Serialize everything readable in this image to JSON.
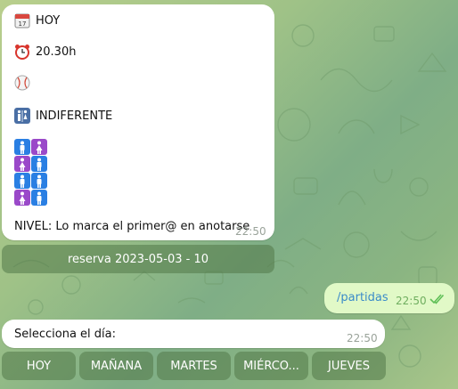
{
  "colors": {
    "bubble_in": "#ffffff",
    "bubble_out": "#e1f9c7",
    "link": "#3a8bc9",
    "time": "#9aa39a",
    "keyboard_button": "#5a7f4c",
    "read_check": "#5fbf57"
  },
  "message_bot": {
    "lines": [
      {
        "icon": "calendar-icon",
        "text": "HOY"
      },
      {
        "icon": "alarm-clock-icon",
        "text": "20.30h"
      },
      {
        "icon": "ball-icon",
        "text": ""
      },
      {
        "icon": "restroom-icon",
        "text": "INDIFERENTE"
      }
    ],
    "player_grid": [
      "man",
      "woman",
      "woman",
      "man",
      "man",
      "man",
      "woman",
      "man"
    ],
    "level_text": "NIVEL: Lo marca el primer@ en anotarse",
    "time": "22:50"
  },
  "inline_keyboard_1": {
    "button": "reserva 2023-05-03 - 10"
  },
  "message_outgoing": {
    "text": "/partidas",
    "time": "22:50"
  },
  "message_prompt": {
    "text": "Selecciona el día:",
    "time": "22:50"
  },
  "reply_keyboard": {
    "buttons": [
      "HOY",
      "MAÑANA",
      "MARTES",
      "MIÉRCO...",
      "JUEVES"
    ]
  }
}
